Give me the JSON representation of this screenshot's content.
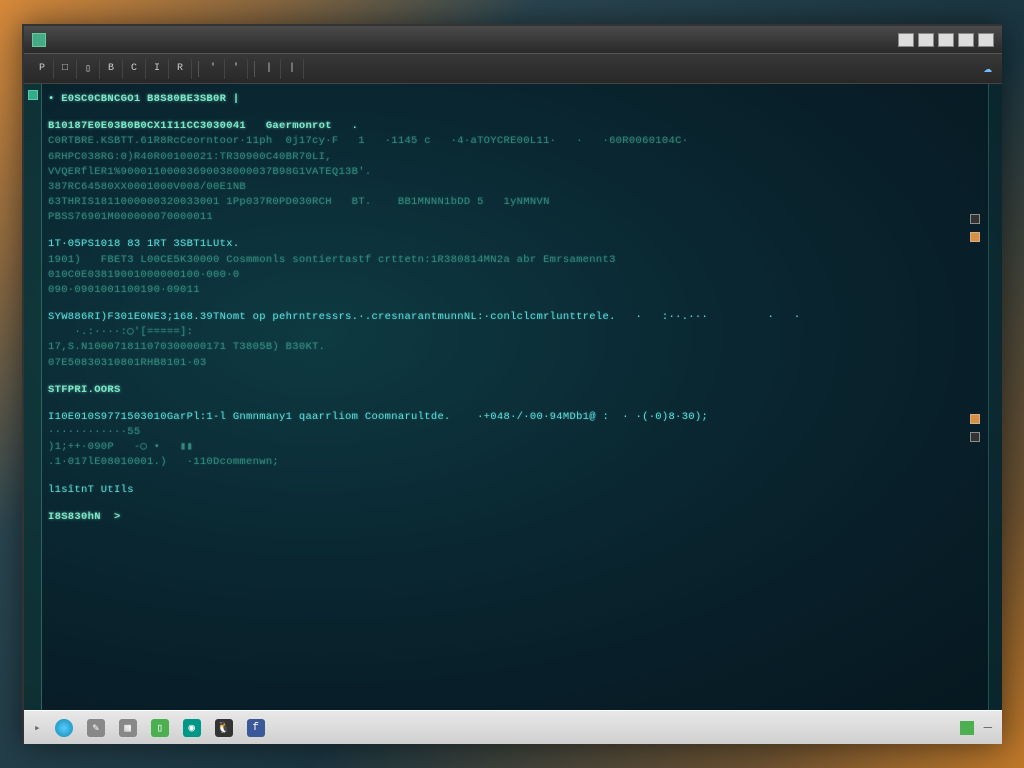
{
  "window": {
    "controls": [
      "min",
      "max",
      "close",
      "extra1",
      "extra2"
    ]
  },
  "toolbar": {
    "items": [
      "P",
      "□",
      "▯",
      "B",
      "C",
      "I",
      "R",
      "'",
      "'",
      "|",
      "|"
    ]
  },
  "terminal": {
    "lines": [
      {
        "cls": "bright",
        "t": "• E0SC0CBNCGO1 B8S80BE3SB0R |"
      },
      {
        "cls": "blank",
        "t": ""
      },
      {
        "cls": "bright",
        "t": "B10187E0E03B0B0CX1I11CC3030041   Gaermonrot   ."
      },
      {
        "cls": "dim",
        "t": "C0RTBRE.KSBTT.61R8RcCeorntoor·11ph  0j17cy·F   1   ·1145 c   ·4·aTOYCRE00L11·   ·   ·60R0060104C·"
      },
      {
        "cls": "dim",
        "t": "6RHPC038RG:0)R40R00100021:TR30900C40BR70LI,"
      },
      {
        "cls": "dim",
        "t": "VVQERflER1%90001100003690038000037B98G1VATEQ13B′."
      },
      {
        "cls": "dim",
        "t": "387RC64580XX0001000V008/00E1NB"
      },
      {
        "cls": "dim",
        "t": "63THRIS1811000000320033001 1Pp037R0PD030RCH   BT.    BB1MNNN1bDD 5   1yNMNVN"
      },
      {
        "cls": "dim",
        "t": "PBSS76901M000000070000011"
      },
      {
        "cls": "blank",
        "t": ""
      },
      {
        "cls": "cyan",
        "t": "1T·05PS1018 83 1RT 3SBT1LUtx."
      },
      {
        "cls": "dim",
        "t": "1901)   FBET3 L00CE5K30000 Cosmmonls sontiertastf crttetn:1R380814MN2a abr Emrsamennt3"
      },
      {
        "cls": "dim",
        "t": "010C0E03819001000000100·000·0"
      },
      {
        "cls": "dim",
        "t": "090·0901001100190·09011"
      },
      {
        "cls": "blank",
        "t": ""
      },
      {
        "cls": "cyan",
        "t": "SYW886RI)F301E0NE3;168.39TNomt op pehrntressrs.·.cresnarantmunnNL:·conlclcmrlunttrele.   ·   :··.···         ·   ·"
      },
      {
        "cls": "dim",
        "t": "    ·.:····:◯'[=====]:"
      },
      {
        "cls": "dim",
        "t": "17,S.N100071811070300000171 T3805B) B30KT."
      },
      {
        "cls": "dim",
        "t": "07E50830310801RHB8101·03"
      },
      {
        "cls": "blank",
        "t": ""
      },
      {
        "cls": "bright",
        "t": "STFPRI.OORS"
      },
      {
        "cls": "blank",
        "t": ""
      },
      {
        "cls": "cyan",
        "t": "I10E010S9771503010GarPl:1-l Gnmnmany1 qaarrliom Coomnarultde.    ·+048·/·00·94MDb1@ :  · ·(·0)8·30);"
      },
      {
        "cls": "dim",
        "t": "············55"
      },
      {
        "cls": "dim",
        "t": ")1;++·090P   -◯ •   ▮▮"
      },
      {
        "cls": "dim",
        "t": ".1·017lE08010001.)   ·110Dcommenwn;"
      },
      {
        "cls": "blank",
        "t": ""
      },
      {
        "cls": "cyan",
        "t": "l1sîtnT UtIls "
      },
      {
        "cls": "blank",
        "t": ""
      },
      {
        "cls": "bright",
        "t": "I8S830hN  >"
      }
    ]
  },
  "taskbar": {
    "icons": [
      "arrow",
      "globe",
      "pen",
      "square",
      "doc",
      "cam",
      "penguin",
      "fb"
    ]
  }
}
